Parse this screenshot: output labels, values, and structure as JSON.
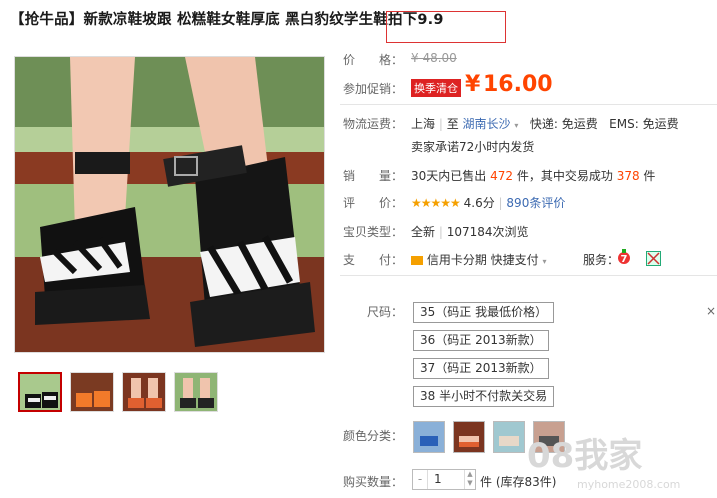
{
  "title": "【抢牛品】新款凉鞋坡跟 松糕鞋女鞋厚底 黑白豹纹学生鞋拍下9.9",
  "price": {
    "label": "价　　格：",
    "value": "¥ 48.00"
  },
  "promo": {
    "label": "参加促销：",
    "badge": "换季清仓",
    "currency": "¥",
    "value": "16.00"
  },
  "shipping": {
    "label": "物流运费：",
    "from": "上海",
    "sep": "至",
    "to": "湖南长沙",
    "arrow": "▾",
    "express": "快递: 免运费",
    "ems": "EMS: 免运费",
    "promise": "卖家承诺72小时内发货"
  },
  "sales": {
    "label": "销　　量：",
    "pre": "30天内已售出",
    "count": "472",
    "mid": "件，其中交易成功",
    "success": "378",
    "unit": "件"
  },
  "rating": {
    "label": "评　　价：",
    "stars": "★★★★★",
    "score": "4.6分",
    "sep": "|",
    "reviews": "890条评价"
  },
  "item_type": {
    "label": "宝贝类型：",
    "value": "全新",
    "sep": "|",
    "views": "107184次浏览"
  },
  "payment": {
    "label": "支　　付：",
    "credit": "信用卡分期",
    "quick": "快捷支付",
    "arrow": "▾",
    "service_label": "服务："
  },
  "size": {
    "label": "尺码：",
    "options": [
      "35（码正 我最低价格）",
      "36（码正 2013新款）",
      "37（码正 2013新款）",
      "38 半小时不付款关交易"
    ]
  },
  "color": {
    "label": "颜色分类："
  },
  "quantity": {
    "label": "购买数量：",
    "minus": "-",
    "value": "1",
    "stock": "件 (库存83件)"
  },
  "watermark": {
    "main": "08我家",
    "sub": "myhome2008.com"
  },
  "colors": {
    "accent": "#ff4400",
    "badge": "#dd2222",
    "highlight": "#dd3333"
  }
}
